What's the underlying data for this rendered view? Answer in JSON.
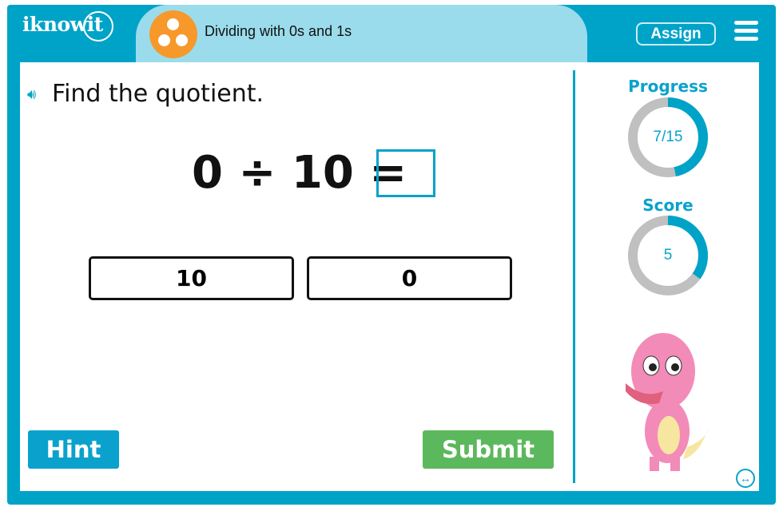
{
  "header": {
    "logo": "iknowit",
    "topic_title": "Dividing with 0s and 1s",
    "assign_label": "Assign",
    "topic_icon": "three-dots-icon",
    "menu_icon": "hamburger-icon"
  },
  "question": {
    "prompt": "Find the quotient.",
    "equation": "0 ÷ 10 =",
    "answer_value": ""
  },
  "choices": [
    {
      "label": "10"
    },
    {
      "label": "0"
    }
  ],
  "buttons": {
    "hint": "Hint",
    "submit": "Submit"
  },
  "stats": {
    "progress_label": "Progress",
    "progress_text": "7/15",
    "progress_fraction": 0.467,
    "score_label": "Score",
    "score_text": "5",
    "score_fraction": 0.35
  },
  "colors": {
    "brand": "#00a3c8",
    "topic_bar": "#9bdcec",
    "topic_icon": "#f7982b",
    "submit": "#5cb85c",
    "ring_bg": "#c0c0c0"
  }
}
